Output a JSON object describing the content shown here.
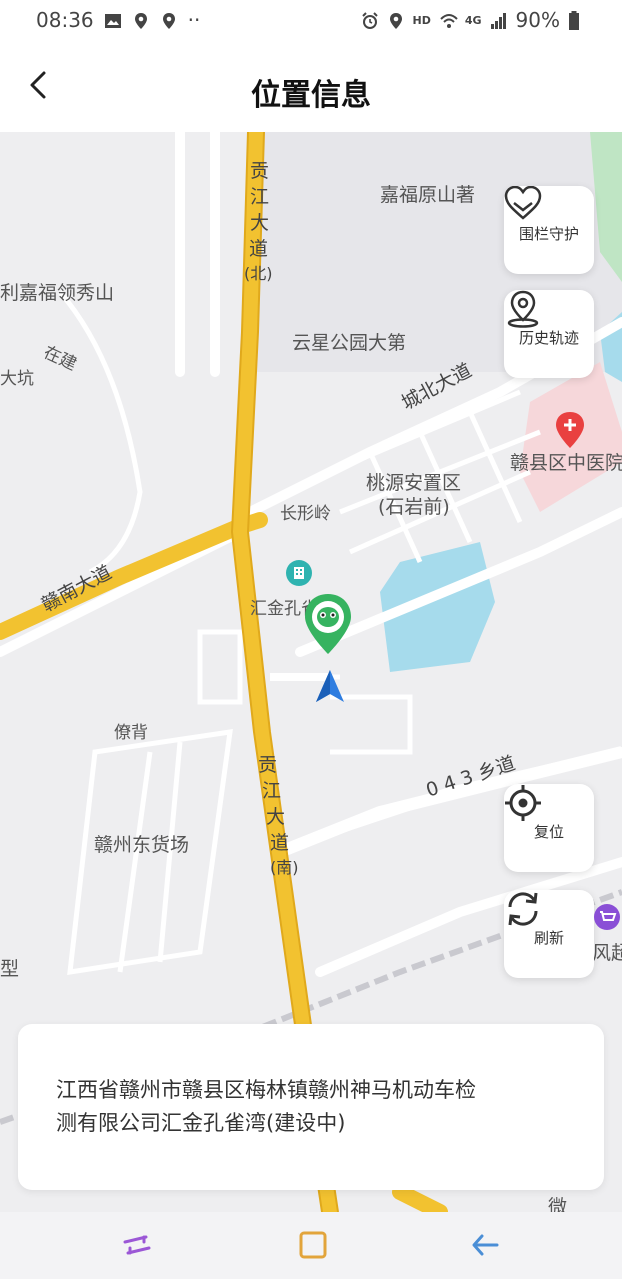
{
  "status_bar": {
    "time": "08:36",
    "dots": "··",
    "hd": "HD",
    "net": "4G",
    "battery": "90%"
  },
  "header": {
    "title": "位置信息",
    "back_icon": "chevron-left-icon"
  },
  "map": {
    "labels": {
      "jiafu_yuanshan": "嘉福原山著",
      "lijiafu_lingxiushan": "利嘉福领秀山",
      "yunxing_park": "云星公园大第",
      "zaijian": "在建",
      "dakeng": "大坑",
      "chengbei_road": "城北大道",
      "ganxian_hospital": "赣县区中医院",
      "taoyuan": "桃源安置区",
      "shiyanqian": "(石岩前)",
      "changxingling": "长形岭",
      "gannan_road": "赣南大道",
      "huijin_kongque": "汇金孔雀湾",
      "liaobei": "僚背",
      "road_043": "0 4 3 乡道",
      "ganzhou_freight": "赣州东货场",
      "gongjiang_north_1": "贡",
      "gongjiang_north_2": "江",
      "gongjiang_north_3": "大",
      "gongjiang_north_4": "道",
      "gongjiang_north_5": "(北)",
      "gongjiang_south_1": "贡",
      "gongjiang_south_2": "江",
      "gongjiang_south_3": "大",
      "gongjiang_south_4": "道",
      "gongjiang_south_5": "(南)",
      "edge_xing": "型",
      "edge_chao": "风超",
      "edge_wei": "微"
    },
    "buttons": {
      "fence": "围栏守护",
      "history": "历史轨迹",
      "reset": "复位",
      "refresh": "刷新"
    },
    "colors": {
      "road_major": "#f2c230",
      "water": "#a6dbec",
      "green": "#bfe5c4",
      "hospital_red": "#e94040",
      "marker_green": "#36b360",
      "arrow_blue": "#2f7de0"
    }
  },
  "address": {
    "text": "江西省赣州市赣县区梅林镇赣州神马机动车检测有限公司汇金孔雀湾(建设中)"
  },
  "navbar": {
    "recent_icon": "recent-apps-icon",
    "home_icon": "home-square-icon",
    "back_icon": "back-arrow-icon"
  }
}
